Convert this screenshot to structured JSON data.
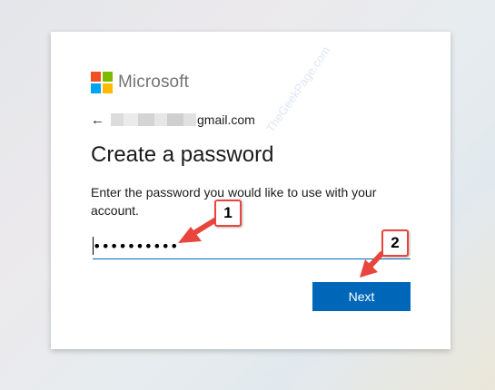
{
  "brand": {
    "name": "Microsoft",
    "colors": [
      "#f25022",
      "#7fba00",
      "#00a4ef",
      "#ffb900"
    ]
  },
  "identity": {
    "back_icon": "back-arrow-icon",
    "email_suffix": "gmail.com"
  },
  "title": "Create a password",
  "description": "Enter the password you would like to use with your account.",
  "password_field": {
    "value": "••••••••••"
  },
  "next_button": {
    "label": "Next"
  },
  "watermark": {
    "text": "TheGeekPage.com"
  },
  "annotations": {
    "first": "1",
    "second": "2",
    "color": "#e8453c"
  },
  "accent_color": "#0067b8"
}
